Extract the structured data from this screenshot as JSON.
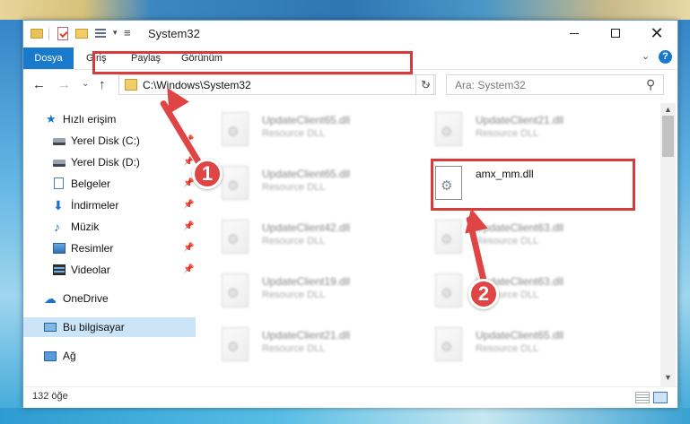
{
  "window": {
    "title": "System32"
  },
  "ribbon": {
    "tabs": [
      {
        "label": "Dosya",
        "active": true
      },
      {
        "label": "Giriş",
        "active": false
      },
      {
        "label": "Paylaş",
        "active": false
      },
      {
        "label": "Görünüm",
        "active": false
      }
    ],
    "help_label": "?"
  },
  "address": {
    "path": "C:\\Windows\\System32"
  },
  "search": {
    "placeholder": "Ara: System32"
  },
  "sidebar": {
    "items": [
      {
        "label": "Hızlı erişim",
        "icon": "star-icon",
        "pinned": false
      },
      {
        "label": "Yerel Disk (C:)",
        "icon": "drive-icon",
        "pinned": true
      },
      {
        "label": "Yerel Disk (D:)",
        "icon": "drive-icon",
        "pinned": true
      },
      {
        "label": "Belgeler",
        "icon": "documents-icon",
        "pinned": true
      },
      {
        "label": "İndirmeler",
        "icon": "downloads-icon",
        "pinned": true
      },
      {
        "label": "Müzik",
        "icon": "music-icon",
        "pinned": true
      },
      {
        "label": "Resimler",
        "icon": "pictures-icon",
        "pinned": true
      },
      {
        "label": "Videolar",
        "icon": "videos-icon",
        "pinned": true
      },
      {
        "label": "OneDrive",
        "icon": "onedrive-icon",
        "pinned": false
      },
      {
        "label": "Bu bilgisayar",
        "icon": "this-pc-icon",
        "pinned": false,
        "selected": true
      },
      {
        "label": "Ağ",
        "icon": "network-icon",
        "pinned": false
      }
    ]
  },
  "files": [
    {
      "name": "UpdateClient65.dll",
      "type": "Resource DLL"
    },
    {
      "name": "UpdateClient21.dll",
      "type": "Resource DLL"
    },
    {
      "name": "UpdateClient65.dll",
      "type": "Resource DLL"
    },
    {
      "name": "amx_mm.dll",
      "type": ""
    },
    {
      "name": "UpdateClient42.dll",
      "type": "Resource DLL"
    },
    {
      "name": "UpdateClient63.dll",
      "type": "Resource DLL"
    },
    {
      "name": "UpdateClient19.dll",
      "type": "Resource DLL"
    },
    {
      "name": "UpdateClient63.dll",
      "type": "Resource DLL"
    },
    {
      "name": "UpdateClient21.dll",
      "type": "Resource DLL"
    },
    {
      "name": "UpdateClient65.dll",
      "type": "Resource DLL"
    }
  ],
  "status": {
    "item_count": "132 öğe"
  },
  "annotations": {
    "step1": "1",
    "step2": "2",
    "highlight_color": "#d93b3b"
  },
  "colors": {
    "accent": "#1979ca",
    "selection": "#cce4f7",
    "highlight": "#d93b3b"
  }
}
